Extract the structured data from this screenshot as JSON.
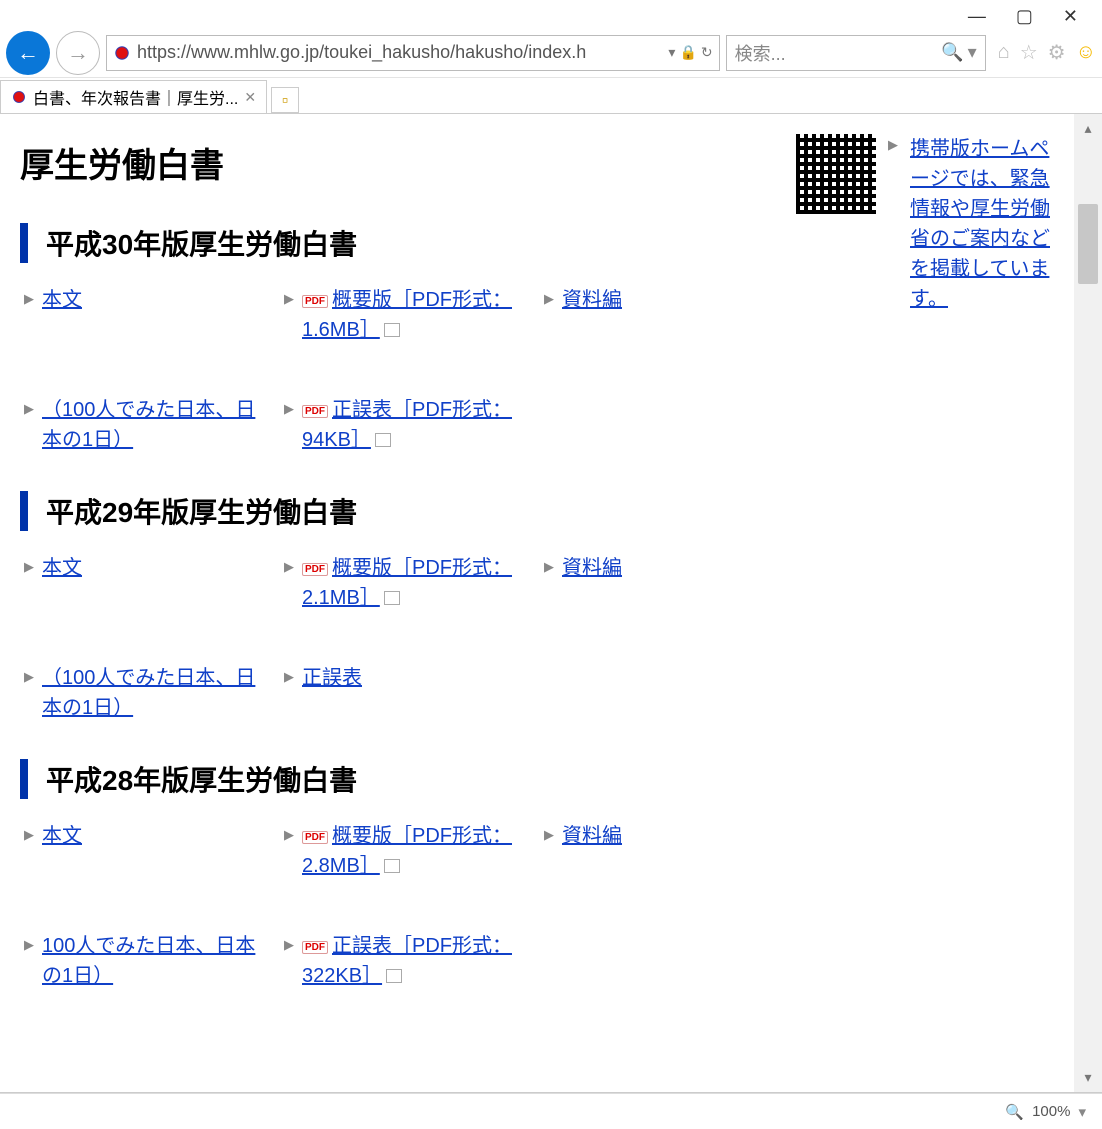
{
  "browser": {
    "url": "https://www.mhlw.go.jp/toukei_hakusho/hakusho/index.h",
    "search_placeholder": "検索...",
    "tab_title": "白書、年次報告書｜厚生労...",
    "zoom": "100%"
  },
  "page": {
    "title": "厚生労働白書",
    "side_link": "携帯版ホームページでは、緊急情報や厚生労働省のご案内などを掲載しています。",
    "sections": [
      {
        "heading": "平成30年版厚生労働白書",
        "items": [
          {
            "label": "本文",
            "pdf": false,
            "open": false
          },
          {
            "label": "概要版［PDF形式：1.6MB］",
            "pdf": true,
            "open": true
          },
          {
            "label": "資料編",
            "pdf": false,
            "open": false
          },
          {
            "label": "（100人でみた日本、日本の1日）",
            "pdf": false,
            "open": false
          },
          {
            "label": "正誤表［PDF形式：94KB］",
            "pdf": true,
            "open": true
          },
          {
            "label": "",
            "pdf": false,
            "open": false
          }
        ]
      },
      {
        "heading": "平成29年版厚生労働白書",
        "items": [
          {
            "label": "本文",
            "pdf": false,
            "open": false
          },
          {
            "label": "概要版［PDF形式：2.1MB］",
            "pdf": true,
            "open": true
          },
          {
            "label": "資料編",
            "pdf": false,
            "open": false
          },
          {
            "label": "（100人でみた日本、日本の1日）",
            "pdf": false,
            "open": false
          },
          {
            "label": "正誤表",
            "pdf": false,
            "open": false
          },
          {
            "label": "",
            "pdf": false,
            "open": false
          }
        ]
      },
      {
        "heading": "平成28年版厚生労働白書",
        "items": [
          {
            "label": "本文",
            "pdf": false,
            "open": false
          },
          {
            "label": "概要版［PDF形式：2.8MB］",
            "pdf": true,
            "open": true
          },
          {
            "label": "資料編",
            "pdf": false,
            "open": false
          },
          {
            "label": "100人でみた日本、日本の1日）",
            "pdf": false,
            "open": false
          },
          {
            "label": "正誤表［PDF形式：322KB］",
            "pdf": true,
            "open": true
          },
          {
            "label": "",
            "pdf": false,
            "open": false
          }
        ]
      }
    ]
  }
}
